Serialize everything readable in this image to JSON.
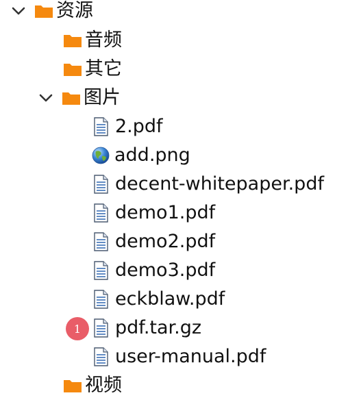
{
  "tree": {
    "root": {
      "label": "资源",
      "expanded": true
    },
    "children": [
      {
        "label": "音频"
      },
      {
        "label": "其它"
      },
      {
        "label": "图片",
        "expanded": true
      }
    ],
    "files": [
      {
        "label": "2.pdf",
        "icon": "pdf-file-icon"
      },
      {
        "label": "add.png",
        "icon": "globe-icon"
      },
      {
        "label": "decent-whitepaper.pdf",
        "icon": "pdf-file-icon"
      },
      {
        "label": "demo1.pdf",
        "icon": "pdf-file-icon"
      },
      {
        "label": "demo2.pdf",
        "icon": "pdf-file-icon"
      },
      {
        "label": "demo3.pdf",
        "icon": "pdf-file-icon"
      },
      {
        "label": "eckblaw.pdf",
        "icon": "pdf-file-icon"
      },
      {
        "label": "pdf.tar.gz",
        "icon": "file-icon"
      },
      {
        "label": "user-manual.pdf",
        "icon": "pdf-file-icon"
      }
    ],
    "last_folder": {
      "label": "视频"
    }
  },
  "badge": {
    "text": "1"
  },
  "colors": {
    "folder": "#f5890f",
    "badge": "#e95d68",
    "file_lines": "#3b6fb6",
    "chevron": "#333333"
  }
}
